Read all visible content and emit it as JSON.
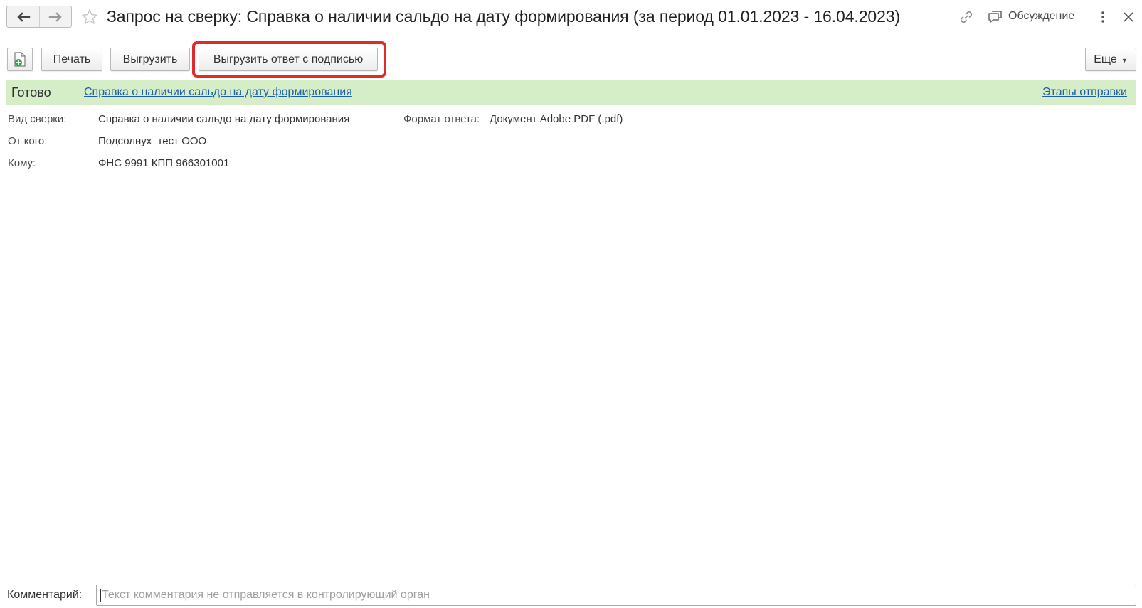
{
  "window": {
    "title": "Запрос на сверку: Справка о наличии сальдо на дату формирования (за период 01.01.2023 - 16.04.2023)",
    "discussion_label": "Обсуждение",
    "icons": [
      "arrow-left-icon",
      "arrow-right-icon",
      "star-icon",
      "link-icon",
      "chat-icon",
      "more-vertical-icon",
      "close-icon"
    ]
  },
  "toolbar": {
    "new_icon": "new-document-icon",
    "print_label": "Печать",
    "export_label": "Выгрузить",
    "export_signed_label": "Выгрузить ответ с подписью",
    "more_label": "Еще",
    "highlight_color": "#e02b2b"
  },
  "status": {
    "text": "Готово",
    "document_link": "Справка о наличии сальдо на дату формирования",
    "stages_link": "Этапы отправки",
    "background_color": "#d6eec8",
    "link_color": "#1f5fa8"
  },
  "details": {
    "type_label": "Вид сверки:",
    "type_value": "Справка о наличии сальдо на дату формирования",
    "format_label": "Формат ответа:",
    "format_value": "Документ Adobe PDF (.pdf)",
    "from_label": "От кого:",
    "from_value": "Подсолнух_тест ООО",
    "to_label": "Кому:",
    "to_value": "ФНС 9991 КПП 966301001"
  },
  "comment": {
    "label": "Комментарий:",
    "value": "",
    "placeholder": "Текст комментария не отправляется в контролирующий орган"
  }
}
